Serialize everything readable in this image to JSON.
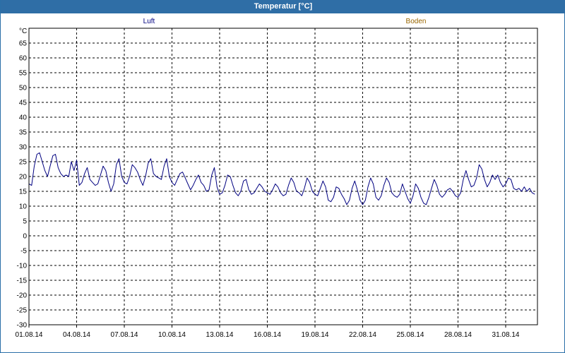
{
  "window": {
    "title": "Temperatur [°C]"
  },
  "chart_data": {
    "type": "line",
    "title": "Temperatur [°C]",
    "ylabel": "°C",
    "ylim": [
      -30,
      70
    ],
    "yticks": [
      65,
      60,
      55,
      50,
      45,
      40,
      35,
      30,
      25,
      20,
      15,
      10,
      5,
      0,
      -5,
      -10,
      -15,
      -20,
      -25,
      -30
    ],
    "xlim": [
      "2014-08-01",
      "2014-09-02"
    ],
    "xticks": [
      "01.08.14",
      "04.08.14",
      "07.08.14",
      "10.08.14",
      "13.08.14",
      "16.08.14",
      "19.08.14",
      "22.08.14",
      "25.08.14",
      "28.08.14",
      "31.08.14"
    ],
    "grid": true,
    "legend": [
      {
        "name": "Luft",
        "color": "#000080"
      },
      {
        "name": "Boden",
        "color": "#996600"
      }
    ],
    "series": [
      {
        "name": "Luft",
        "color": "#000080",
        "points": [
          [
            "2014-08-01 00:00",
            17.5
          ],
          [
            "2014-08-01 04:00",
            17.0
          ],
          [
            "2014-08-01 08:00",
            23.5
          ],
          [
            "2014-08-01 12:00",
            27.5
          ],
          [
            "2014-08-01 16:00",
            28.0
          ],
          [
            "2014-08-01 20:00",
            25.0
          ],
          [
            "2014-08-02 00:00",
            22.0
          ],
          [
            "2014-08-02 04:00",
            20.0
          ],
          [
            "2014-08-02 08:00",
            23.5
          ],
          [
            "2014-08-02 12:00",
            27.0
          ],
          [
            "2014-08-02 16:00",
            27.5
          ],
          [
            "2014-08-02 20:00",
            23.0
          ],
          [
            "2014-08-03 00:00",
            21.0
          ],
          [
            "2014-08-03 04:00",
            20.0
          ],
          [
            "2014-08-03 08:00",
            20.5
          ],
          [
            "2014-08-03 12:00",
            20.0
          ],
          [
            "2014-08-03 16:00",
            25.0
          ],
          [
            "2014-08-03 20:00",
            22.0
          ],
          [
            "2014-08-04 00:00",
            25.5
          ],
          [
            "2014-08-04 04:00",
            17.0
          ],
          [
            "2014-08-04 08:00",
            18.0
          ],
          [
            "2014-08-04 12:00",
            21.0
          ],
          [
            "2014-08-04 16:00",
            23.0
          ],
          [
            "2014-08-04 20:00",
            19.0
          ],
          [
            "2014-08-05 00:00",
            18.0
          ],
          [
            "2014-08-05 04:00",
            17.0
          ],
          [
            "2014-08-05 08:00",
            17.5
          ],
          [
            "2014-08-05 12:00",
            20.5
          ],
          [
            "2014-08-05 16:00",
            23.5
          ],
          [
            "2014-08-05 20:00",
            22.0
          ],
          [
            "2014-08-06 00:00",
            18.0
          ],
          [
            "2014-08-06 04:00",
            15.0
          ],
          [
            "2014-08-06 08:00",
            17.5
          ],
          [
            "2014-08-06 12:00",
            24.0
          ],
          [
            "2014-08-06 16:00",
            26.0
          ],
          [
            "2014-08-06 20:00",
            20.0
          ],
          [
            "2014-08-07 00:00",
            18.0
          ],
          [
            "2014-08-07 04:00",
            17.5
          ],
          [
            "2014-08-07 08:00",
            20.0
          ],
          [
            "2014-08-07 12:00",
            24.0
          ],
          [
            "2014-08-07 16:00",
            23.0
          ],
          [
            "2014-08-07 20:00",
            21.5
          ],
          [
            "2014-08-08 00:00",
            19.0
          ],
          [
            "2014-08-08 04:00",
            17.0
          ],
          [
            "2014-08-08 08:00",
            20.0
          ],
          [
            "2014-08-08 12:00",
            24.5
          ],
          [
            "2014-08-08 16:00",
            26.0
          ],
          [
            "2014-08-08 20:00",
            21.0
          ],
          [
            "2014-08-09 00:00",
            20.0
          ],
          [
            "2014-08-09 04:00",
            19.5
          ],
          [
            "2014-08-09 08:00",
            19.0
          ],
          [
            "2014-08-09 12:00",
            23.5
          ],
          [
            "2014-08-09 16:00",
            26.0
          ],
          [
            "2014-08-09 20:00",
            20.0
          ],
          [
            "2014-08-10 00:00",
            18.0
          ],
          [
            "2014-08-10 04:00",
            17.0
          ],
          [
            "2014-08-10 08:00",
            19.0
          ],
          [
            "2014-08-10 12:00",
            21.0
          ],
          [
            "2014-08-10 16:00",
            21.5
          ],
          [
            "2014-08-10 20:00",
            19.5
          ],
          [
            "2014-08-11 00:00",
            17.5
          ],
          [
            "2014-08-11 04:00",
            15.5
          ],
          [
            "2014-08-11 08:00",
            17.0
          ],
          [
            "2014-08-11 12:00",
            19.0
          ],
          [
            "2014-08-11 16:00",
            20.5
          ],
          [
            "2014-08-11 20:00",
            18.0
          ],
          [
            "2014-08-12 00:00",
            17.0
          ],
          [
            "2014-08-12 04:00",
            15.0
          ],
          [
            "2014-08-12 08:00",
            15.5
          ],
          [
            "2014-08-12 12:00",
            20.5
          ],
          [
            "2014-08-12 16:00",
            23.0
          ],
          [
            "2014-08-12 20:00",
            16.5
          ],
          [
            "2014-08-13 00:00",
            14.0
          ],
          [
            "2014-08-13 04:00",
            14.5
          ],
          [
            "2014-08-13 08:00",
            17.0
          ],
          [
            "2014-08-13 12:00",
            20.5
          ],
          [
            "2014-08-13 16:00",
            20.0
          ],
          [
            "2014-08-13 20:00",
            17.0
          ],
          [
            "2014-08-14 00:00",
            14.5
          ],
          [
            "2014-08-14 04:00",
            13.5
          ],
          [
            "2014-08-14 08:00",
            15.0
          ],
          [
            "2014-08-14 12:00",
            18.5
          ],
          [
            "2014-08-14 16:00",
            19.0
          ],
          [
            "2014-08-14 20:00",
            15.5
          ],
          [
            "2014-08-15 00:00",
            14.0
          ],
          [
            "2014-08-15 04:00",
            14.5
          ],
          [
            "2014-08-15 08:00",
            16.0
          ],
          [
            "2014-08-15 12:00",
            17.5
          ],
          [
            "2014-08-15 16:00",
            16.5
          ],
          [
            "2014-08-15 20:00",
            15.0
          ],
          [
            "2014-08-16 00:00",
            14.5
          ],
          [
            "2014-08-16 04:00",
            14.0
          ],
          [
            "2014-08-16 08:00",
            15.5
          ],
          [
            "2014-08-16 12:00",
            17.5
          ],
          [
            "2014-08-16 16:00",
            16.5
          ],
          [
            "2014-08-16 20:00",
            14.5
          ],
          [
            "2014-08-17 00:00",
            13.5
          ],
          [
            "2014-08-17 04:00",
            14.0
          ],
          [
            "2014-08-17 08:00",
            17.0
          ],
          [
            "2014-08-17 12:00",
            19.5
          ],
          [
            "2014-08-17 16:00",
            18.0
          ],
          [
            "2014-08-17 20:00",
            15.0
          ],
          [
            "2014-08-18 00:00",
            14.5
          ],
          [
            "2014-08-18 04:00",
            13.5
          ],
          [
            "2014-08-18 08:00",
            16.0
          ],
          [
            "2014-08-18 12:00",
            19.5
          ],
          [
            "2014-08-18 16:00",
            18.0
          ],
          [
            "2014-08-18 20:00",
            15.0
          ],
          [
            "2014-08-19 00:00",
            14.0
          ],
          [
            "2014-08-19 04:00",
            13.5
          ],
          [
            "2014-08-19 08:00",
            16.0
          ],
          [
            "2014-08-19 12:00",
            18.5
          ],
          [
            "2014-08-19 16:00",
            16.5
          ],
          [
            "2014-08-19 20:00",
            12.0
          ],
          [
            "2014-08-20 00:00",
            11.5
          ],
          [
            "2014-08-20 04:00",
            13.0
          ],
          [
            "2014-08-20 08:00",
            16.5
          ],
          [
            "2014-08-20 12:00",
            16.0
          ],
          [
            "2014-08-20 16:00",
            14.0
          ],
          [
            "2014-08-20 20:00",
            12.5
          ],
          [
            "2014-08-21 00:00",
            10.5
          ],
          [
            "2014-08-21 04:00",
            12.0
          ],
          [
            "2014-08-21 08:00",
            16.0
          ],
          [
            "2014-08-21 12:00",
            18.5
          ],
          [
            "2014-08-21 16:00",
            15.5
          ],
          [
            "2014-08-21 20:00",
            12.0
          ],
          [
            "2014-08-22 00:00",
            10.5
          ],
          [
            "2014-08-22 04:00",
            12.0
          ],
          [
            "2014-08-22 08:00",
            16.5
          ],
          [
            "2014-08-22 12:00",
            19.5
          ],
          [
            "2014-08-22 16:00",
            17.5
          ],
          [
            "2014-08-22 20:00",
            13.0
          ],
          [
            "2014-08-23 00:00",
            12.0
          ],
          [
            "2014-08-23 04:00",
            13.5
          ],
          [
            "2014-08-23 08:00",
            17.0
          ],
          [
            "2014-08-23 12:00",
            19.5
          ],
          [
            "2014-08-23 16:00",
            18.0
          ],
          [
            "2014-08-23 20:00",
            14.5
          ],
          [
            "2014-08-24 00:00",
            13.5
          ],
          [
            "2014-08-24 04:00",
            13.0
          ],
          [
            "2014-08-24 08:00",
            14.0
          ],
          [
            "2014-08-24 12:00",
            17.5
          ],
          [
            "2014-08-24 16:00",
            15.0
          ],
          [
            "2014-08-24 20:00",
            12.5
          ],
          [
            "2014-08-25 00:00",
            11.0
          ],
          [
            "2014-08-25 04:00",
            13.5
          ],
          [
            "2014-08-25 08:00",
            17.5
          ],
          [
            "2014-08-25 12:00",
            16.0
          ],
          [
            "2014-08-25 16:00",
            13.0
          ],
          [
            "2014-08-25 20:00",
            11.0
          ],
          [
            "2014-08-26 00:00",
            10.5
          ],
          [
            "2014-08-26 04:00",
            13.0
          ],
          [
            "2014-08-26 08:00",
            16.0
          ],
          [
            "2014-08-26 12:00",
            19.0
          ],
          [
            "2014-08-26 16:00",
            17.0
          ],
          [
            "2014-08-26 20:00",
            14.0
          ],
          [
            "2014-08-27 00:00",
            13.0
          ],
          [
            "2014-08-27 04:00",
            14.0
          ],
          [
            "2014-08-27 08:00",
            15.5
          ],
          [
            "2014-08-27 12:00",
            16.0
          ],
          [
            "2014-08-27 16:00",
            15.0
          ],
          [
            "2014-08-27 20:00",
            13.5
          ],
          [
            "2014-08-28 00:00",
            13.0
          ],
          [
            "2014-08-28 04:00",
            14.5
          ],
          [
            "2014-08-28 08:00",
            19.0
          ],
          [
            "2014-08-28 12:00",
            22.0
          ],
          [
            "2014-08-28 16:00",
            19.0
          ],
          [
            "2014-08-28 20:00",
            16.5
          ],
          [
            "2014-08-29 00:00",
            17.0
          ],
          [
            "2014-08-29 04:00",
            19.5
          ],
          [
            "2014-08-29 08:00",
            24.0
          ],
          [
            "2014-08-29 12:00",
            22.5
          ],
          [
            "2014-08-29 16:00",
            19.0
          ],
          [
            "2014-08-29 20:00",
            16.5
          ],
          [
            "2014-08-30 00:00",
            18.0
          ],
          [
            "2014-08-30 04:00",
            20.5
          ],
          [
            "2014-08-30 08:00",
            19.0
          ],
          [
            "2014-08-30 12:00",
            20.5
          ],
          [
            "2014-08-30 16:00",
            18.0
          ],
          [
            "2014-08-30 20:00",
            16.5
          ],
          [
            "2014-08-31 00:00",
            17.5
          ],
          [
            "2014-08-31 04:00",
            19.5
          ],
          [
            "2014-08-31 08:00",
            19.0
          ],
          [
            "2014-08-31 12:00",
            16.0
          ],
          [
            "2014-08-31 16:00",
            15.5
          ],
          [
            "2014-08-31 20:00",
            16.0
          ],
          [
            "2014-09-01 00:00",
            15.0
          ],
          [
            "2014-09-01 04:00",
            16.5
          ],
          [
            "2014-09-01 08:00",
            15.0
          ],
          [
            "2014-09-01 12:00",
            16.0
          ],
          [
            "2014-09-01 16:00",
            14.5
          ],
          [
            "2014-09-01 20:00",
            14.0
          ]
        ]
      }
    ]
  }
}
